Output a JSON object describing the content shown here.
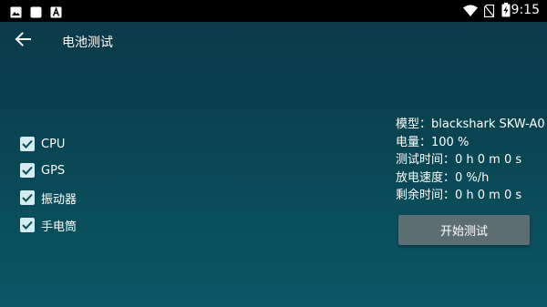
{
  "status_bar": {
    "time": "9:15",
    "icons": [
      "gallery-icon",
      "square-notification-icon",
      "font-app-icon",
      "wifi-icon",
      "no-sim-icon",
      "battery-charging-icon"
    ]
  },
  "app_bar": {
    "title": "电池测试",
    "back_icon": "arrow-back-icon"
  },
  "options": [
    {
      "label": "CPU",
      "checked": true
    },
    {
      "label": "GPS",
      "checked": true
    },
    {
      "label": "振动器",
      "checked": true
    },
    {
      "label": "手电筒",
      "checked": true
    }
  ],
  "info": {
    "model": "模型：blackshark SKW-A0",
    "battery": "电量：100 %",
    "test_time": "测试时间：0 h 0 m 0 s",
    "discharge_rate": "放电速度：0 %/h",
    "remaining_time": "剩余时间：0 h 0 m 0 s"
  },
  "start_button": {
    "label": "开始测试"
  },
  "colors": {
    "background_top": "#0b3847",
    "background_bottom": "#0b5866",
    "checkbox_fill": "#d4ecef",
    "checkmark": "#0b4a57",
    "button_bg": "#5d6e73"
  }
}
